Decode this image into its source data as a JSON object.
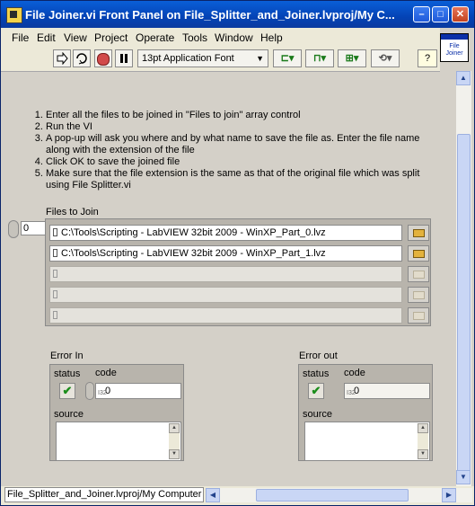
{
  "window": {
    "title": "File Joiner.vi Front Panel on File_Splitter_and_Joiner.lvproj/My C..."
  },
  "title_buttons": {
    "minimize": "–",
    "maximize": "□",
    "close": "✕"
  },
  "menu": [
    "File",
    "Edit",
    "View",
    "Project",
    "Operate",
    "Tools",
    "Window",
    "Help"
  ],
  "vi_icon": {
    "line1": "File",
    "line2": "Joiner"
  },
  "toolbar": {
    "font": "13pt Application Font",
    "help": "?"
  },
  "instructions": [
    "Enter all the files to be joined in \"Files to join\" array control",
    "Run the VI",
    "A pop-up will ask you where and by what name to save the file as. Enter the file name along with the extension of the file",
    "Click OK to save the joined file",
    "Make sure that the file extension is the same as that of the original file which was split using File Splitter.vi"
  ],
  "files_to_join": {
    "label": "Files to Join",
    "index": "0",
    "paths": [
      "C:\\Tools\\Scripting - LabVIEW 32bit 2009 - WinXP_Part_0.lvz",
      "C:\\Tools\\Scripting - LabVIEW 32bit 2009 - WinXP_Part_1.lvz",
      "",
      "",
      ""
    ]
  },
  "error_in": {
    "label": "Error In",
    "status_label": "status",
    "code_label": "code",
    "code": "0",
    "source_label": "source",
    "source": ""
  },
  "error_out": {
    "label": "Error out",
    "status_label": "status",
    "code_label": "code",
    "code": "0",
    "source_label": "source",
    "source": ""
  },
  "status_bar": {
    "context": "File_Splitter_and_Joiner.lvproj/My Computer"
  }
}
